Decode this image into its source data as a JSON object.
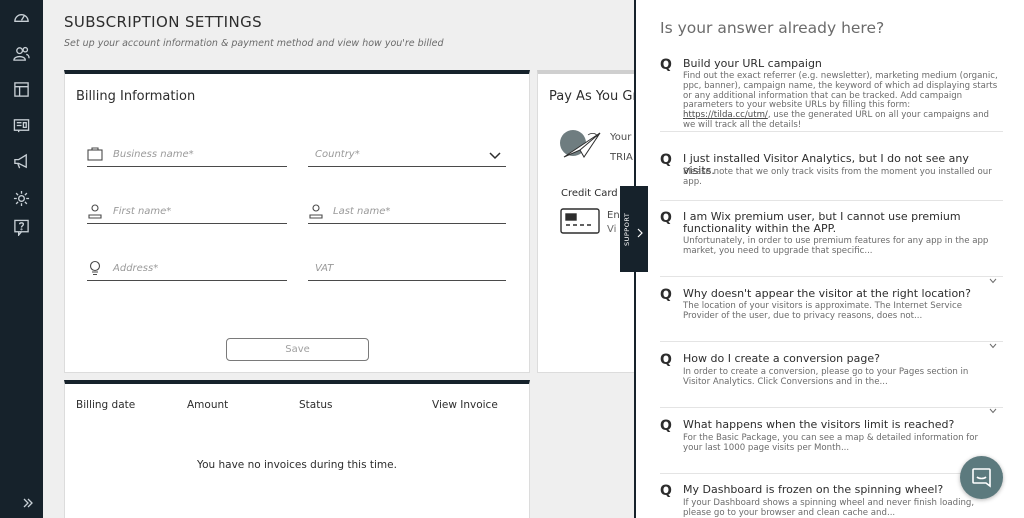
{
  "sidebar": {
    "icons": [
      "dashboard-icon",
      "visitors-icon",
      "pages-icon",
      "widgets-icon",
      "campaigns-icon",
      "settings-icon",
      "help-icon"
    ],
    "expand_icon": "double-chevron-right-icon"
  },
  "page": {
    "title": "SUBSCRIPTION SETTINGS",
    "subtitle": "Set up your account information & payment method and view how you're billed"
  },
  "billing": {
    "title": "Billing Information",
    "fields": {
      "business_name": "Business name*",
      "country": "Country*",
      "first_name": "First name*",
      "last_name": "Last name*",
      "address": "Address*",
      "vat": "VAT"
    },
    "save_label": "Save"
  },
  "plan": {
    "title": "Pay As You Gr",
    "your": "Your",
    "trial": "TRIA",
    "credit_card_label": "Credit Card",
    "cc_line1": "En",
    "cc_line2": "Vi"
  },
  "invoices": {
    "columns": [
      "Billing date",
      "Amount",
      "Status",
      "View Invoice"
    ],
    "empty_message": "You have no invoices during this time."
  },
  "support_tab": {
    "label": "SUPPORT"
  },
  "help": {
    "title": "Is your answer already here?",
    "q_mark": "Q",
    "faqs": [
      {
        "question": "Build your URL campaign",
        "answer": "Find out the exact referrer (e.g. newsletter), marketing medium (organic, ppc, banner), campaign name, the keyword of which ad displaying starts or any additional information that can be tracked. Add campaign parameters to your website URLs by filling this form: ",
        "answer_link": "https://tilda.cc/utm/",
        "answer_tail": ", use the generated URL on all your campaigns and we will track all the details!"
      },
      {
        "question": "I just installed Visitor Analytics, but I do not see any visits.",
        "answer": "Please note that we only track visits from the moment you installed our app."
      },
      {
        "question": "I am Wix premium user, but I cannot use premium functionality within the APP.",
        "answer": "Unfortunately, in order to use premium features for any app in the app market, you need to upgrade that specific..."
      },
      {
        "question": "Why doesn't appear the visitor at the right location?",
        "answer": "The location of your visitors is approximate. The Internet Service Provider of the user, due to privacy reasons, does not..."
      },
      {
        "question": "How do I create a conversion page?",
        "answer": "In order to create a conversion, please go to your Pages section in Visitor Analytics. Click Conversions and in the..."
      },
      {
        "question": "What happens when the visitors limit is reached?",
        "answer": "For the Basic Package, you can see a map & detailed information for your last 1000 page visits per Month..."
      },
      {
        "question": "My Dashboard is frozen on the spinning wheel?",
        "answer": "If your Dashboard shows a spinning wheel and never finish loading, please go to your browser and clean cache and..."
      }
    ]
  },
  "chat_button_icon": "chat-icon",
  "colors": {
    "sidebar": "#16222b",
    "chat": "#5c7a7e",
    "background": "#efefef"
  }
}
